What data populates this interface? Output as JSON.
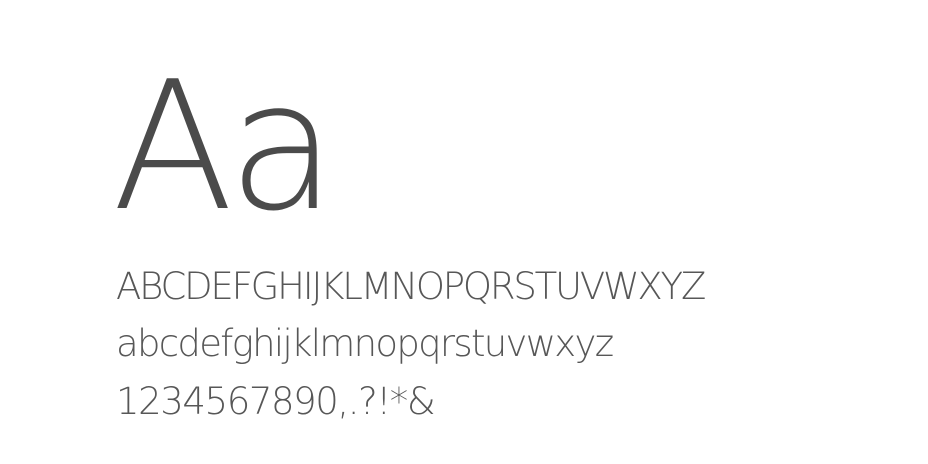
{
  "specimen": {
    "sample": "Aa",
    "uppercase": "ABCDEFGHIJKLMNOPQRSTUVWXYZ",
    "lowercase": "abcdefghijklmnopqrstuvwxyz",
    "numerals": "1234567890,.?!*&"
  },
  "colors": {
    "background": "#ffffff",
    "text": "#4a4a4a"
  }
}
